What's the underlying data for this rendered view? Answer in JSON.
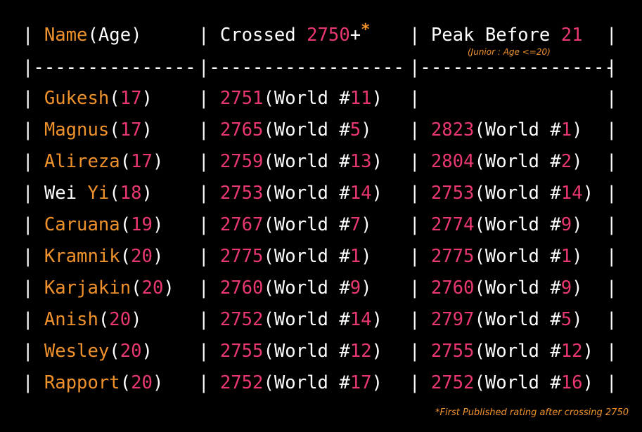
{
  "header": {
    "col1_name": "Name",
    "col1_age": "(Age)",
    "col2_label": "Crossed ",
    "col2_value": "2750",
    "col2_plus": "+",
    "col2_star": "*",
    "col3_label": "Peak Before ",
    "col3_value": "21",
    "col3_note": "(Junior : Age <=20)"
  },
  "divider": {
    "seg1": "---------------",
    "seg2": "------------------",
    "seg3": "------------------"
  },
  "rows": [
    {
      "name": "Gukesh",
      "age": "17",
      "cross_rating": "2751",
      "cross_rank": "11",
      "peak_rating": "",
      "peak_rank": ""
    },
    {
      "name": "Magnus",
      "age": "17",
      "cross_rating": "2765",
      "cross_rank": "5",
      "peak_rating": "2823",
      "peak_rank": "1"
    },
    {
      "name": "Alireza",
      "age": "17",
      "cross_rating": "2759",
      "cross_rank": "13",
      "peak_rating": "2804",
      "peak_rank": "2"
    },
    {
      "name_white": "Wei ",
      "name": "Yi",
      "age": "18",
      "cross_rating": "2753",
      "cross_rank": "14",
      "peak_rating": "2753",
      "peak_rank": "14"
    },
    {
      "name": "Caruana",
      "age": "19",
      "cross_rating": "2767",
      "cross_rank": "7",
      "peak_rating": "2774",
      "peak_rank": "9"
    },
    {
      "name": "Kramnik",
      "age": "20",
      "cross_rating": "2775",
      "cross_rank": "1",
      "peak_rating": "2775",
      "peak_rank": "1"
    },
    {
      "name": "Karjakin",
      "age": "20",
      "cross_rating": "2760",
      "cross_rank": "9",
      "peak_rating": "2760",
      "peak_rank": "9"
    },
    {
      "name": "Anish",
      "age": "20",
      "cross_rating": "2752",
      "cross_rank": "14",
      "peak_rating": "2797",
      "peak_rank": "5"
    },
    {
      "name": "Wesley",
      "age": "20",
      "cross_rating": "2755",
      "cross_rank": "12",
      "peak_rating": "2755",
      "peak_rank": "12"
    },
    {
      "name": "Rapport",
      "age": "20",
      "cross_rating": "2752",
      "cross_rank": "17",
      "peak_rating": "2752",
      "peak_rank": "16"
    }
  ],
  "labels": {
    "world_prefix": "(World #",
    "world_suffix": ")",
    "open_paren": "(",
    "close_paren": ")",
    "pipe": "| "
  },
  "footnote": "*First Published rating after crossing 2750",
  "colors": {
    "accent_orange": "#f0922b",
    "accent_pink": "#e8386f",
    "text": "#ffffff",
    "background": "#000000"
  }
}
